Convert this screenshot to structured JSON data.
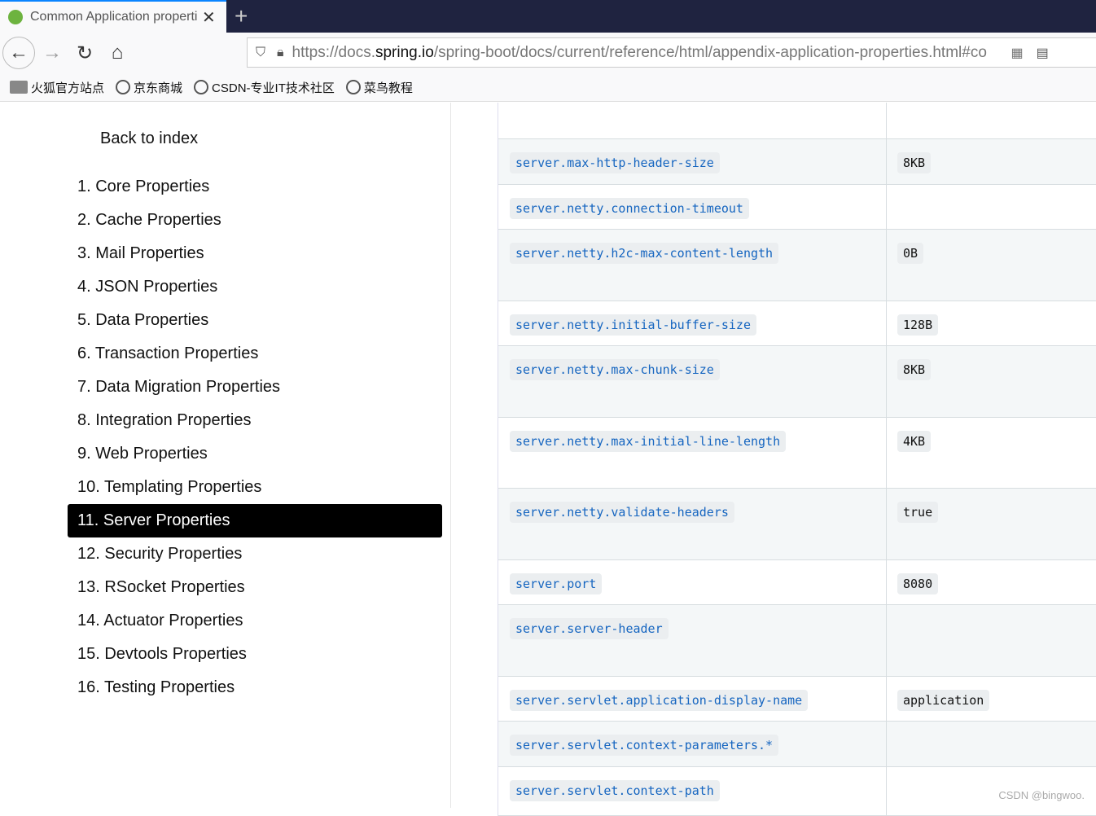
{
  "browser": {
    "tab_title": "Common Application properties",
    "url_pre": "https://docs.",
    "url_host": "spring.io",
    "url_post": "/spring-boot/docs/current/reference/html/appendix-application-properties.html#co",
    "bookmarks": [
      "火狐官方站点",
      "京东商城",
      "CSDN-专业IT技术社区",
      "菜鸟教程"
    ]
  },
  "sidebar": {
    "back": "Back to index",
    "active_index": 10,
    "items": [
      "1. Core Properties",
      "2. Cache Properties",
      "3. Mail Properties",
      "4. JSON Properties",
      "5. Data Properties",
      "6. Transaction Properties",
      "7. Data Migration Properties",
      "8. Integration Properties",
      "9. Web Properties",
      "10. Templating Properties",
      "11. Server Properties",
      "12. Security Properties",
      "13. RSocket Properties",
      "14. Actuator Properties",
      "15. Devtools Properties",
      "16. Testing Properties"
    ]
  },
  "table": {
    "rows": [
      {
        "name": "",
        "default": ""
      },
      {
        "name": "server.max-http-header-size",
        "default": "8KB"
      },
      {
        "name": "server.netty.connection-timeout",
        "default": ""
      },
      {
        "name": "server.netty.h2c-max-content-length",
        "default": "0B"
      },
      {
        "name": "server.netty.initial-buffer-size",
        "default": "128B"
      },
      {
        "name": "server.netty.max-chunk-size",
        "default": "8KB"
      },
      {
        "name": "server.netty.max-initial-line-length",
        "default": "4KB"
      },
      {
        "name": "server.netty.validate-headers",
        "default": "true"
      },
      {
        "name": "server.port",
        "default": "8080"
      },
      {
        "name": "server.server-header",
        "default": ""
      },
      {
        "name": "server.servlet.application-display-name",
        "default": "application"
      },
      {
        "name": "server.servlet.context-parameters.*",
        "default": ""
      },
      {
        "name": "server.servlet.context-path",
        "default": ""
      }
    ]
  },
  "watermark": "CSDN @bingwoo."
}
